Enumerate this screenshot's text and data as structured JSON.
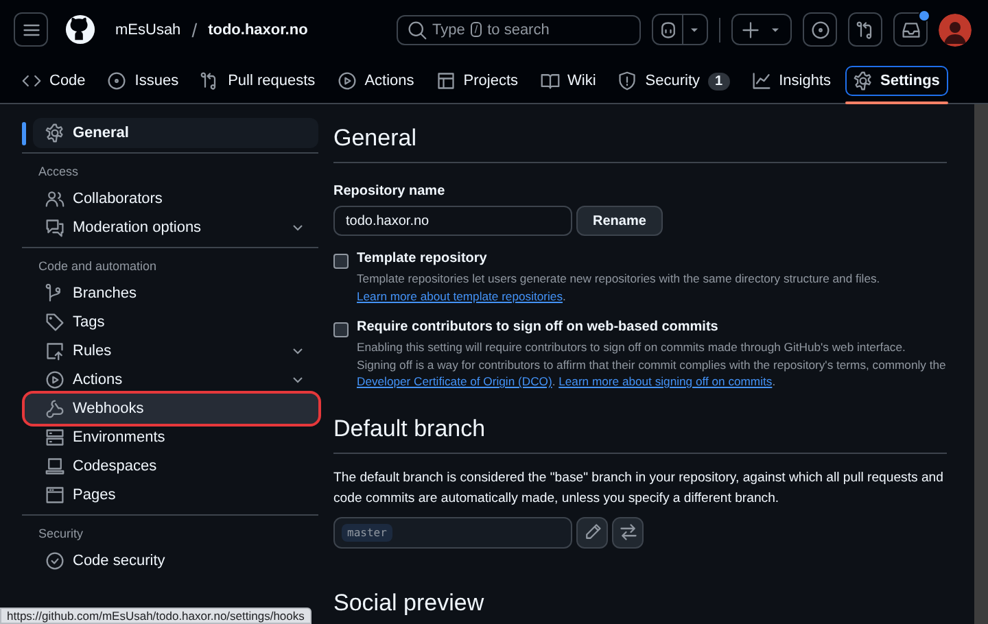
{
  "header": {
    "owner": "mEsUsah",
    "separator": "/",
    "repo": "todo.haxor.no",
    "search": {
      "placeholder_before": "Type",
      "key": "/",
      "placeholder_after": "to search"
    },
    "inbox_unread": true
  },
  "tabs": [
    {
      "label": "Code",
      "selected": false
    },
    {
      "label": "Issues",
      "selected": false
    },
    {
      "label": "Pull requests",
      "selected": false
    },
    {
      "label": "Actions",
      "selected": false
    },
    {
      "label": "Projects",
      "selected": false
    },
    {
      "label": "Wiki",
      "selected": false
    },
    {
      "label": "Security",
      "selected": false,
      "counter": "1"
    },
    {
      "label": "Insights",
      "selected": false
    },
    {
      "label": "Settings",
      "selected": true
    }
  ],
  "sidebar": {
    "groups": [
      {
        "items": [
          {
            "label": "General",
            "selected": true,
            "expandable": false,
            "highlighted": false
          }
        ]
      },
      {
        "heading": "Access",
        "items": [
          {
            "label": "Collaborators",
            "selected": false,
            "expandable": false,
            "highlighted": false
          },
          {
            "label": "Moderation options",
            "selected": false,
            "expandable": true,
            "highlighted": false
          }
        ]
      },
      {
        "heading": "Code and automation",
        "items": [
          {
            "label": "Branches",
            "selected": false,
            "expandable": false,
            "highlighted": false
          },
          {
            "label": "Tags",
            "selected": false,
            "expandable": false,
            "highlighted": false
          },
          {
            "label": "Rules",
            "selected": false,
            "expandable": true,
            "highlighted": false
          },
          {
            "label": "Actions",
            "selected": false,
            "expandable": true,
            "highlighted": false
          },
          {
            "label": "Webhooks",
            "selected": false,
            "expandable": false,
            "highlighted": true
          },
          {
            "label": "Environments",
            "selected": false,
            "expandable": false,
            "highlighted": false
          },
          {
            "label": "Codespaces",
            "selected": false,
            "expandable": false,
            "highlighted": false
          },
          {
            "label": "Pages",
            "selected": false,
            "expandable": false,
            "highlighted": false
          }
        ]
      },
      {
        "heading": "Security",
        "items": [
          {
            "label": "Code security",
            "selected": false,
            "expandable": false,
            "highlighted": false
          }
        ]
      }
    ]
  },
  "main": {
    "title": "General",
    "repository_name": {
      "label": "Repository name",
      "value": "todo.haxor.no",
      "button": "Rename"
    },
    "options": [
      {
        "label": "Template repository",
        "checked": false,
        "description": [
          {
            "text": "Template repositories let users generate new repositories with the same directory structure and files. "
          },
          {
            "link": "Learn more about template repositories"
          },
          {
            "text": "."
          }
        ]
      },
      {
        "label": "Require contributors to sign off on web-based commits",
        "checked": false,
        "description": [
          {
            "text": "Enabling this setting will require contributors to sign off on commits made through GitHub's web interface. Signing off is a way for contributors to affirm that their commit complies with the repository's terms, commonly the "
          },
          {
            "link": "Developer Certificate of Origin (DCO)"
          },
          {
            "text": ". "
          },
          {
            "link": "Learn more about signing off on commits"
          },
          {
            "text": "."
          }
        ]
      }
    ],
    "default_branch": {
      "title": "Default branch",
      "description": "The default branch is considered the \"base\" branch in your repository, against which all pull requests and code commits are automatically made, unless you specify a different branch.",
      "branch": "master"
    },
    "next_section": "Social preview"
  },
  "status_bar": "https://github.com/mEsUsah/todo.haxor.no/settings/hooks"
}
